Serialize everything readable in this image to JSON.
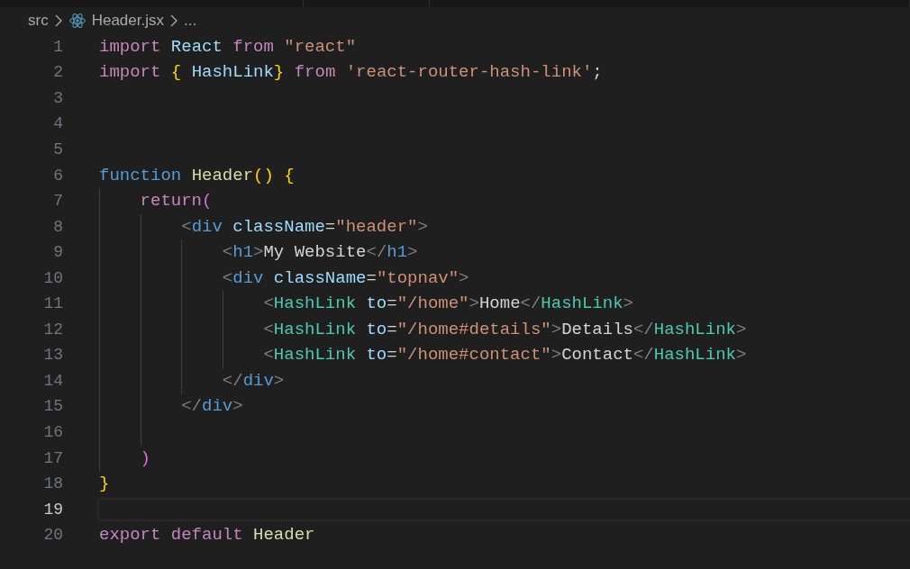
{
  "breadcrumbs": [
    {
      "kind": "folder",
      "label": "src"
    },
    {
      "kind": "react-file",
      "label": "Header.jsx"
    },
    {
      "kind": "more",
      "label": "..."
    }
  ],
  "lines": [
    {
      "number": "1",
      "current": false,
      "tokens": [
        {
          "kind": "keyword",
          "t": "import "
        },
        {
          "kind": "variable",
          "t": "React "
        },
        {
          "kind": "keyword",
          "t": "from "
        },
        {
          "kind": "string",
          "t": "\"react\""
        }
      ]
    },
    {
      "number": "2",
      "current": false,
      "tokens": [
        {
          "kind": "keyword",
          "t": "import "
        },
        {
          "kind": "bracket1",
          "t": "{ "
        },
        {
          "kind": "variable",
          "t": "HashLink"
        },
        {
          "kind": "bracket1",
          "t": "} "
        },
        {
          "kind": "keyword",
          "t": "from "
        },
        {
          "kind": "string",
          "t": "'react-router-hash-link'"
        },
        {
          "kind": "plain",
          "t": ";"
        }
      ]
    },
    {
      "number": "3",
      "current": false
    },
    {
      "number": "4",
      "current": false
    },
    {
      "number": "5",
      "current": false
    },
    {
      "number": "6",
      "current": false,
      "tokens": [
        {
          "kind": "storage",
          "t": "function "
        },
        {
          "kind": "function",
          "t": "Header"
        },
        {
          "kind": "bracket1",
          "t": "() {"
        }
      ]
    },
    {
      "number": "7",
      "current": false,
      "tokens": [
        {
          "kind": "keyword",
          "t": "    return"
        },
        {
          "kind": "bracket2",
          "t": "("
        }
      ]
    },
    {
      "number": "8",
      "current": false,
      "tokens": [
        {
          "kind": "punct",
          "t": "        <"
        },
        {
          "kind": "tag",
          "t": "div "
        },
        {
          "kind": "variable",
          "t": "className"
        },
        {
          "kind": "plain",
          "t": "="
        },
        {
          "kind": "string",
          "t": "\"header\""
        },
        {
          "kind": "punct",
          "t": ">"
        }
      ]
    },
    {
      "number": "9",
      "current": false,
      "tokens": [
        {
          "kind": "punct",
          "t": "            <"
        },
        {
          "kind": "tag",
          "t": "h1"
        },
        {
          "kind": "punct",
          "t": ">"
        },
        {
          "kind": "plain",
          "t": "My Website"
        },
        {
          "kind": "punct",
          "t": "</"
        },
        {
          "kind": "tag",
          "t": "h1"
        },
        {
          "kind": "punct",
          "t": ">"
        }
      ]
    },
    {
      "number": "10",
      "current": false,
      "tokens": [
        {
          "kind": "punct",
          "t": "            <"
        },
        {
          "kind": "tag",
          "t": "div "
        },
        {
          "kind": "variable",
          "t": "className"
        },
        {
          "kind": "plain",
          "t": "="
        },
        {
          "kind": "string",
          "t": "\"topnav\""
        },
        {
          "kind": "punct",
          "t": ">"
        }
      ]
    },
    {
      "number": "11",
      "current": false,
      "tokens": [
        {
          "kind": "punct",
          "t": "                <"
        },
        {
          "kind": "component",
          "t": "HashLink "
        },
        {
          "kind": "variable",
          "t": "to"
        },
        {
          "kind": "plain",
          "t": "="
        },
        {
          "kind": "string",
          "t": "\"/home\""
        },
        {
          "kind": "punct",
          "t": ">"
        },
        {
          "kind": "plain",
          "t": "Home"
        },
        {
          "kind": "punct",
          "t": "</"
        },
        {
          "kind": "component",
          "t": "HashLink"
        },
        {
          "kind": "punct",
          "t": ">"
        }
      ]
    },
    {
      "number": "12",
      "current": false,
      "tokens": [
        {
          "kind": "punct",
          "t": "                <"
        },
        {
          "kind": "component",
          "t": "HashLink "
        },
        {
          "kind": "variable",
          "t": "to"
        },
        {
          "kind": "plain",
          "t": "="
        },
        {
          "kind": "string",
          "t": "\"/home#details\""
        },
        {
          "kind": "punct",
          "t": ">"
        },
        {
          "kind": "plain",
          "t": "Details"
        },
        {
          "kind": "punct",
          "t": "</"
        },
        {
          "kind": "component",
          "t": "HashLink"
        },
        {
          "kind": "punct",
          "t": ">"
        }
      ]
    },
    {
      "number": "13",
      "current": false,
      "tokens": [
        {
          "kind": "punct",
          "t": "                <"
        },
        {
          "kind": "component",
          "t": "HashLink "
        },
        {
          "kind": "variable",
          "t": "to"
        },
        {
          "kind": "plain",
          "t": "="
        },
        {
          "kind": "string",
          "t": "\"/home#contact\""
        },
        {
          "kind": "punct",
          "t": ">"
        },
        {
          "kind": "plain",
          "t": "Contact"
        },
        {
          "kind": "punct",
          "t": "</"
        },
        {
          "kind": "component",
          "t": "HashLink"
        },
        {
          "kind": "punct",
          "t": ">"
        }
      ]
    },
    {
      "number": "14",
      "current": false,
      "tokens": [
        {
          "kind": "punct",
          "t": "            </"
        },
        {
          "kind": "tag",
          "t": "div"
        },
        {
          "kind": "punct",
          "t": ">"
        }
      ]
    },
    {
      "number": "15",
      "current": false,
      "tokens": [
        {
          "kind": "punct",
          "t": "        </"
        },
        {
          "kind": "tag",
          "t": "div"
        },
        {
          "kind": "punct",
          "t": ">"
        }
      ]
    },
    {
      "number": "16",
      "current": false
    },
    {
      "number": "17",
      "current": false,
      "tokens": [
        {
          "kind": "bracket2",
          "t": "    )"
        }
      ]
    },
    {
      "number": "18",
      "current": false,
      "tokens": [
        {
          "kind": "bracket1",
          "t": "}"
        }
      ]
    },
    {
      "number": "19",
      "current": true
    },
    {
      "number": "20",
      "current": false,
      "tokens": [
        {
          "kind": "keyword",
          "t": "export default "
        },
        {
          "kind": "function",
          "t": "Header"
        }
      ]
    }
  ]
}
